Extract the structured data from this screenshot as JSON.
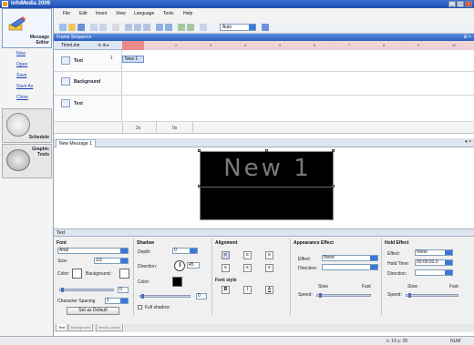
{
  "window": {
    "title": "infoMedia 2009",
    "minimize": "_",
    "maximize": "□",
    "close": "×"
  },
  "leftnav": {
    "message_editor": {
      "label_line1": "Message",
      "label_line2": "Editor"
    },
    "links": [
      "New",
      "Open",
      "Save",
      "Save As",
      "Close"
    ],
    "schedule": {
      "label": "Schedule"
    },
    "graphic_tools": {
      "label_line1": "Graphic",
      "label_line2": "Tools"
    }
  },
  "menubar": {
    "items": [
      "File",
      "Edit",
      "Insert",
      "View",
      "Language",
      "Tools",
      "Help"
    ]
  },
  "toolbar": {
    "zoom_value": "Auto"
  },
  "frame_sequence": {
    "header": "Frame Sequence",
    "pin": "⊞ ×",
    "timeline_label": "TimeLine",
    "ruler_marks": [
      "1",
      "2",
      "3",
      "4",
      "5",
      "6",
      "7",
      "8",
      "9",
      "10"
    ],
    "tracks": [
      {
        "name": "Text",
        "num": "1",
        "clip": "New 1"
      },
      {
        "name": "Background",
        "num": "",
        "clip": ""
      },
      {
        "name": "Text",
        "num": "",
        "clip": ""
      }
    ],
    "time_marks": [
      "2s",
      "0s"
    ]
  },
  "message_tab": {
    "label": "New Message 1",
    "controls": "▾ ×"
  },
  "display": {
    "text": "New 1"
  },
  "properties": {
    "header": "Text",
    "font": {
      "title": "Font",
      "font_value": "Arial",
      "size_label": "Size:",
      "size_value": "1/2",
      "color_label": "Color:",
      "background_label": "Background:",
      "char_spacing_label": "Character Spacing",
      "char_spacing_value": "1",
      "set_default": "Set as Default",
      "slider_value": "0"
    },
    "shadow": {
      "title": "Shadow",
      "depth_label": "Depth:",
      "depth_value": "0",
      "direction_label": "Direction:",
      "direction_value": "45",
      "color_label": "Color:",
      "full_shadow": "Full shadow",
      "slider_value": "0"
    },
    "alignment": {
      "title": "Alignment",
      "font_style_title": "Font style",
      "bold": "B",
      "italic": "I",
      "underline": "A"
    },
    "appearance": {
      "title": "Appearance Effect",
      "effect_label": "Effect:",
      "effect_value": "None",
      "direction_label": "Direction:",
      "slow": "Slow",
      "fast": "Fast",
      "speed_label": "Speed:"
    },
    "hold": {
      "title": "Hold Effect",
      "effect_label": "Effect:",
      "effect_value": "None",
      "hold_time_label": "Hold Time:",
      "hold_time_value": "00:00:02.0",
      "direction_label": "Direction:",
      "slow": "Slow",
      "fast": "Fast",
      "speed_label": "Speed:"
    },
    "subtabs": [
      "Text",
      "Background",
      "Media Library"
    ]
  },
  "status": {
    "coords": "x: 19  y: 28",
    "mode": "NUM"
  },
  "colors": {
    "accent": "#3a78d8",
    "title_bar": "#1e4fae",
    "playhead": "#e88a8a",
    "font_color": "#000000"
  }
}
